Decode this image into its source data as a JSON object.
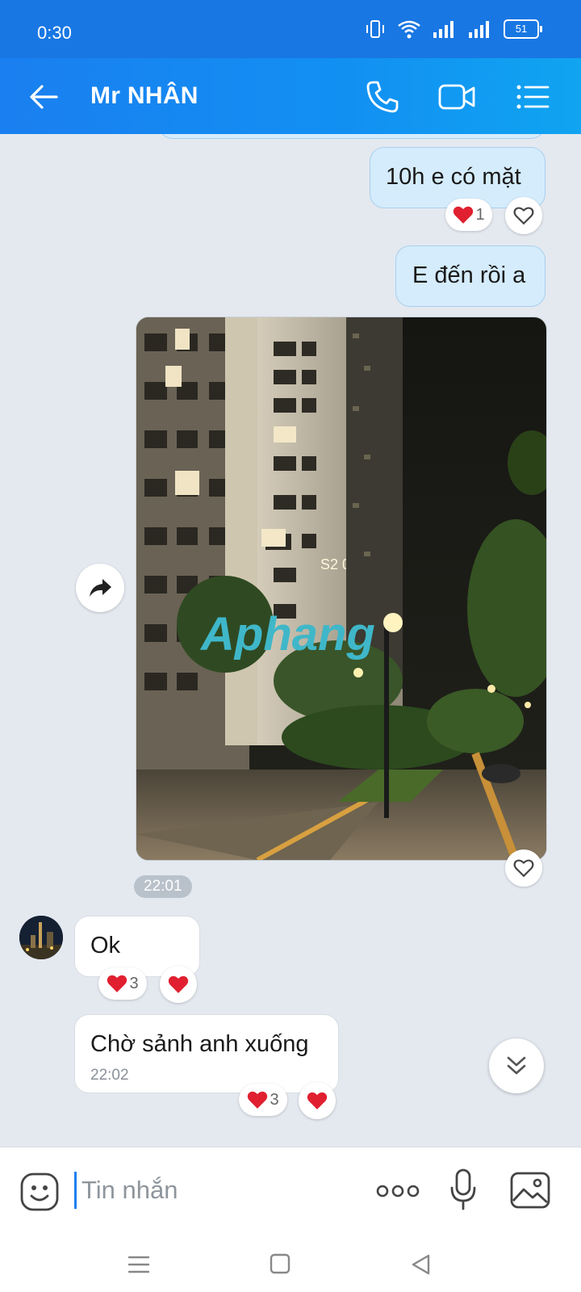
{
  "status_bar": {
    "time": "0:30",
    "battery": "51"
  },
  "header": {
    "contact_name": "Mr NHÂN"
  },
  "messages": {
    "m1": {
      "text": "10h e có mặt",
      "reaction_count": "1"
    },
    "m2": {
      "text": "E đến rồi a"
    },
    "photo": {
      "watermark": "Aphang",
      "building_sign": "S2 02",
      "time": "22:01"
    },
    "m3": {
      "text": "Ok",
      "reaction_count": "3"
    },
    "m4": {
      "text": "Chờ sảnh anh xuống",
      "time": "22:02",
      "reaction_count": "3"
    }
  },
  "composer": {
    "placeholder": "Tin nhắn"
  },
  "colors": {
    "header": "#1a7ff0",
    "outgoing_bubble": "#d5ecfc",
    "heart": "#e02030"
  }
}
